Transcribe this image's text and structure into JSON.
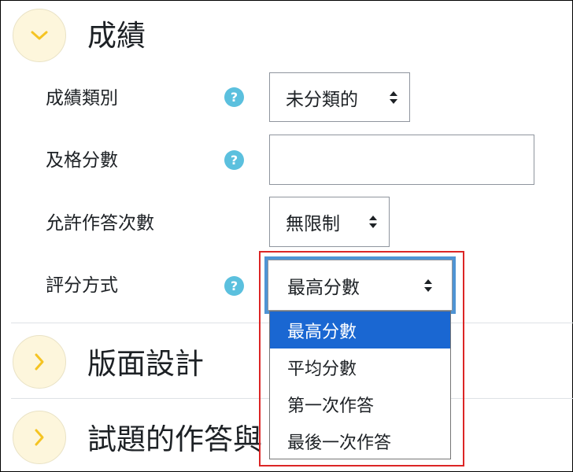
{
  "sections": {
    "grade": {
      "title": "成績"
    },
    "layout": {
      "title": "版面設計"
    },
    "behaviour": {
      "title": "試題的作答與"
    }
  },
  "fields": {
    "grade_category": {
      "label": "成績類別",
      "value": "未分類的"
    },
    "pass_grade": {
      "label": "及格分數",
      "value": ""
    },
    "attempts": {
      "label": "允許作答次數",
      "value": "無限制"
    },
    "grading_method": {
      "label": "評分方式",
      "value": "最高分數"
    }
  },
  "dropdown": {
    "options": [
      "最高分數",
      "平均分數",
      "第一次作答",
      "最後一次作答"
    ],
    "selected_index": 0
  },
  "colors": {
    "accent": "#1a67d2",
    "focus_ring": "#4f94d4",
    "help_icon": "#5bc0de",
    "chevron": "#f5c423",
    "highlight_border": "#dc2626"
  },
  "icons": {
    "collapse": "chevron-down-icon",
    "expand": "chevron-right-icon",
    "help": "help-icon",
    "select": "up-down-arrows-icon"
  }
}
